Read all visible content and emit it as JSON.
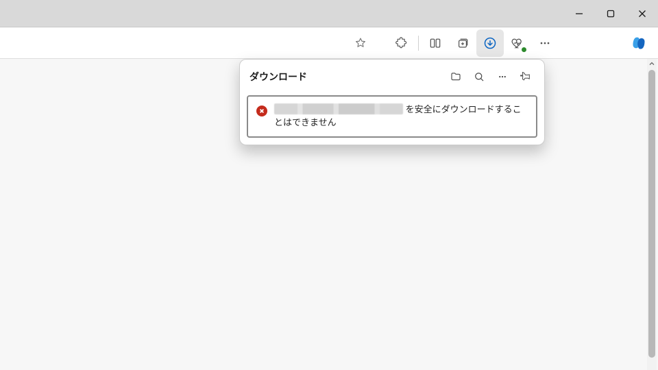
{
  "downloads": {
    "title": "ダウンロード",
    "item": {
      "suffix": " を安全にダウンロードすることはできません"
    }
  }
}
